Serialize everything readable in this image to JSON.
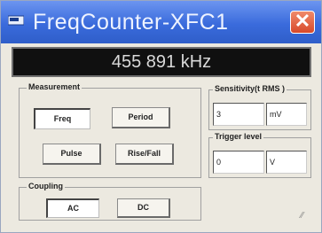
{
  "window": {
    "title": "FreqCounter-XFC1",
    "close_label": "✕",
    "title_icon": "instrument-icon"
  },
  "display": {
    "reading": "455 891 kHz"
  },
  "measurement": {
    "label": "Measurement",
    "buttons": [
      {
        "label": "Freq",
        "pressed": true
      },
      {
        "label": "Period",
        "pressed": false
      },
      {
        "label": "Pulse",
        "pressed": false
      },
      {
        "label": "Rise/Fall",
        "pressed": false
      }
    ]
  },
  "sensitivity": {
    "label": "Sensitivity(t RMS )",
    "value": "3",
    "unit": "mV"
  },
  "trigger": {
    "label": "Trigger level",
    "value": "0",
    "unit": "V"
  },
  "coupling": {
    "label": "Coupling",
    "buttons": [
      {
        "label": "AC",
        "pressed": true
      },
      {
        "label": "DC",
        "pressed": false
      }
    ]
  },
  "resize_grip": "⁄⁄"
}
